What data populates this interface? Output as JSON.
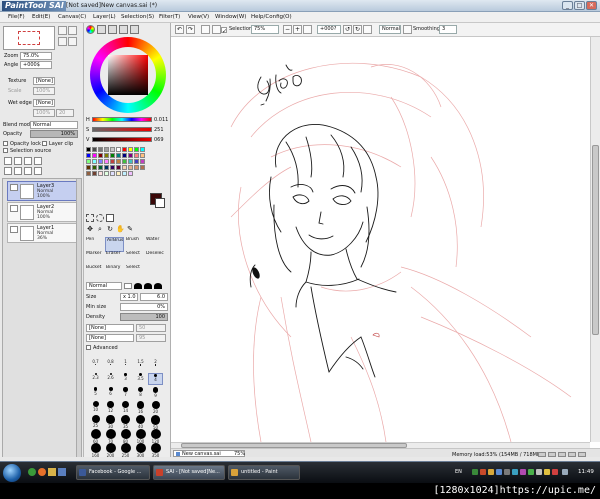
{
  "window": {
    "logo": "PaintTool SAI",
    "title": "[Not saved]New canvas.sai (*)",
    "controls": [
      "_",
      "□",
      "✕"
    ]
  },
  "menu": [
    {
      "key": "file",
      "label": "File(F)"
    },
    {
      "key": "edit",
      "label": "Edit(E)"
    },
    {
      "key": "canvas",
      "label": "Canvas(C)"
    },
    {
      "key": "layer",
      "label": "Layer(L)"
    },
    {
      "key": "selection",
      "label": "Selection(S)"
    },
    {
      "key": "filter",
      "label": "Filter(T)"
    },
    {
      "key": "view",
      "label": "View(V)"
    },
    {
      "key": "window",
      "label": "Window(W)"
    },
    {
      "key": "help",
      "label": "Help/Config(O)"
    }
  ],
  "navigator": {
    "zoom_label": "Zoom",
    "zoom_value": "75.0%",
    "angle_label": "Angle",
    "angle_value": "+000$"
  },
  "paper": {
    "texture_label": "Texture",
    "texture_value": "[None]",
    "scale_label": "Scale",
    "scale_value": "100%",
    "wetedge_label": "Wet edge",
    "wetedge_value": "[None]",
    "width_value": "100%",
    "intensity_value": "20"
  },
  "layer_props": {
    "blend_label": "Blend mode",
    "blend_value": "Normal",
    "opacity_label": "Opacity",
    "opacity_value": "100%",
    "opacity_lock": "Opacity lock",
    "layer_clip": "Layer clip",
    "selection_source": "Selection source"
  },
  "layers": [
    {
      "name": "Layer3",
      "mode": "Normal",
      "opacity": "100%",
      "selected": true
    },
    {
      "name": "Layer2",
      "mode": "Normal",
      "opacity": "100%",
      "selected": false
    },
    {
      "name": "Layer1",
      "mode": "Normal",
      "opacity": "36%",
      "selected": false
    }
  ],
  "color": {
    "h_label": "H",
    "h_value": "0.011",
    "s_label": "S",
    "s_value": "251",
    "v_label": "V",
    "v_value": "069",
    "current": "#3a0808"
  },
  "swatches": [
    "#000000",
    "#4a4a4a",
    "#7a7a7a",
    "#a0a0a0",
    "#c8c8c8",
    "#ffffff",
    "#ff0000",
    "#ffff00",
    "#00ff00",
    "#00ffff",
    "#0000ff",
    "#ff00ff",
    "#800000",
    "#808000",
    "#008000",
    "#008080",
    "#000080",
    "#800080",
    "#ff8080",
    "#ffc080",
    "#80ff80",
    "#80ffff",
    "#8080ff",
    "#ff80ff",
    "#c04040",
    "#c08040",
    "#40c040",
    "#40c0c0",
    "#4040c0",
    "#c040c0",
    "#603000",
    "#306000",
    "#006030",
    "#003060",
    "#300060",
    "#600030",
    "#f0d0b0",
    "#e0b090",
    "#d09070",
    "#b07050",
    "#906040",
    "#704030",
    "#ffe0e0",
    "#e0ffe0",
    "#e0e0ff",
    "#fff0c0",
    "#c0f0ff",
    "#f0c0ff"
  ],
  "tools": [
    {
      "key": "pen",
      "label": "Pen",
      "selected": false
    },
    {
      "key": "airbrush",
      "label": "AirBrush",
      "selected": true
    },
    {
      "key": "brush",
      "label": "Brush",
      "selected": false
    },
    {
      "key": "water",
      "label": "Water",
      "selected": false
    },
    {
      "key": "marker",
      "label": "Marker",
      "selected": false
    },
    {
      "key": "eraser",
      "label": "Eraser",
      "selected": false
    },
    {
      "key": "select",
      "label": "Select",
      "selected": false
    },
    {
      "key": "deselect",
      "label": "Deselect",
      "selected": false
    },
    {
      "key": "bucket",
      "label": "Bucket",
      "selected": false
    },
    {
      "key": "binary",
      "label": "Binary",
      "selected": false
    },
    {
      "key": "select2",
      "label": "Select",
      "selected": false
    }
  ],
  "brush": {
    "mode_value": "Normal",
    "size_label": "Size",
    "size_mult": "x 1.0",
    "size_value": "6.0",
    "minsize_label": "Min size",
    "minsize_value": "0%",
    "density_label": "Density",
    "density_value": "100",
    "shape_value": "[None]",
    "texture_value": "[None]",
    "strength1": "50",
    "strength2": "95",
    "advanced_label": "Advanced"
  },
  "brush_sizes": [
    "0.7",
    "0.8",
    "1",
    "1.5",
    "2",
    "2.3",
    "2.6",
    "3",
    "3.5",
    "4",
    "5",
    "6",
    "7",
    "8",
    "9",
    "10",
    "12",
    "14",
    "16",
    "20",
    "25",
    "30",
    "35",
    "40",
    "50",
    "60",
    "70",
    "80",
    "100",
    "120",
    "160",
    "200",
    "250",
    "300",
    "350",
    "400",
    "450",
    "500"
  ],
  "canvas_toolbar": {
    "selection_label": "Selection",
    "zoom_value": "75%",
    "angle_value": "+000?",
    "mode_value": "Normal",
    "smoothing_label": "Smoothing",
    "smoothing_value": "3"
  },
  "canvas_tab": {
    "label": "New canvas.sai",
    "zoom": "75%"
  },
  "memory": "Memory load:53% (154MB / 718MB)",
  "taskbar": {
    "tasks": [
      {
        "label": "Facebook - Google ...",
        "color": "#3b5998"
      },
      {
        "label": "SAI - [Not saved]Ne...",
        "color": "#c8402a"
      },
      {
        "label": "untitled - Paint",
        "color": "#d9a23a"
      }
    ],
    "lang": "EN",
    "clock": "11:49"
  },
  "watermark": "[1280x1024]https://upic.me/"
}
